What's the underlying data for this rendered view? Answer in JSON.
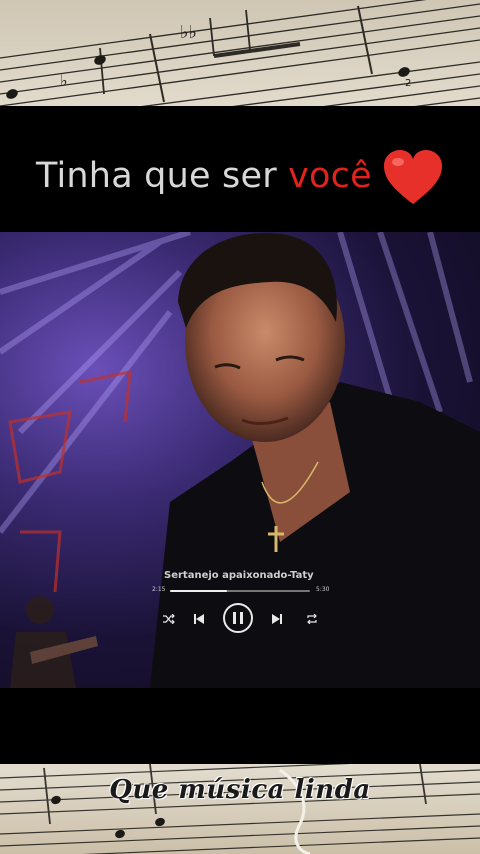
{
  "header": {
    "title_plain": "Tinha que ser ",
    "title_accent": "você"
  },
  "player": {
    "track_title": "Sertanejo apaixonado-Taty",
    "elapsed": "2:15",
    "duration": "5:30",
    "progress": 0.41,
    "icons": [
      "shuffle-icon",
      "previous-icon",
      "pause-icon",
      "next-icon",
      "repeat-icon"
    ]
  },
  "caption": {
    "text": "Que música linda"
  },
  "colors": {
    "accent": "#e0231b",
    "heart": "#e8302a",
    "background": "#000000"
  }
}
